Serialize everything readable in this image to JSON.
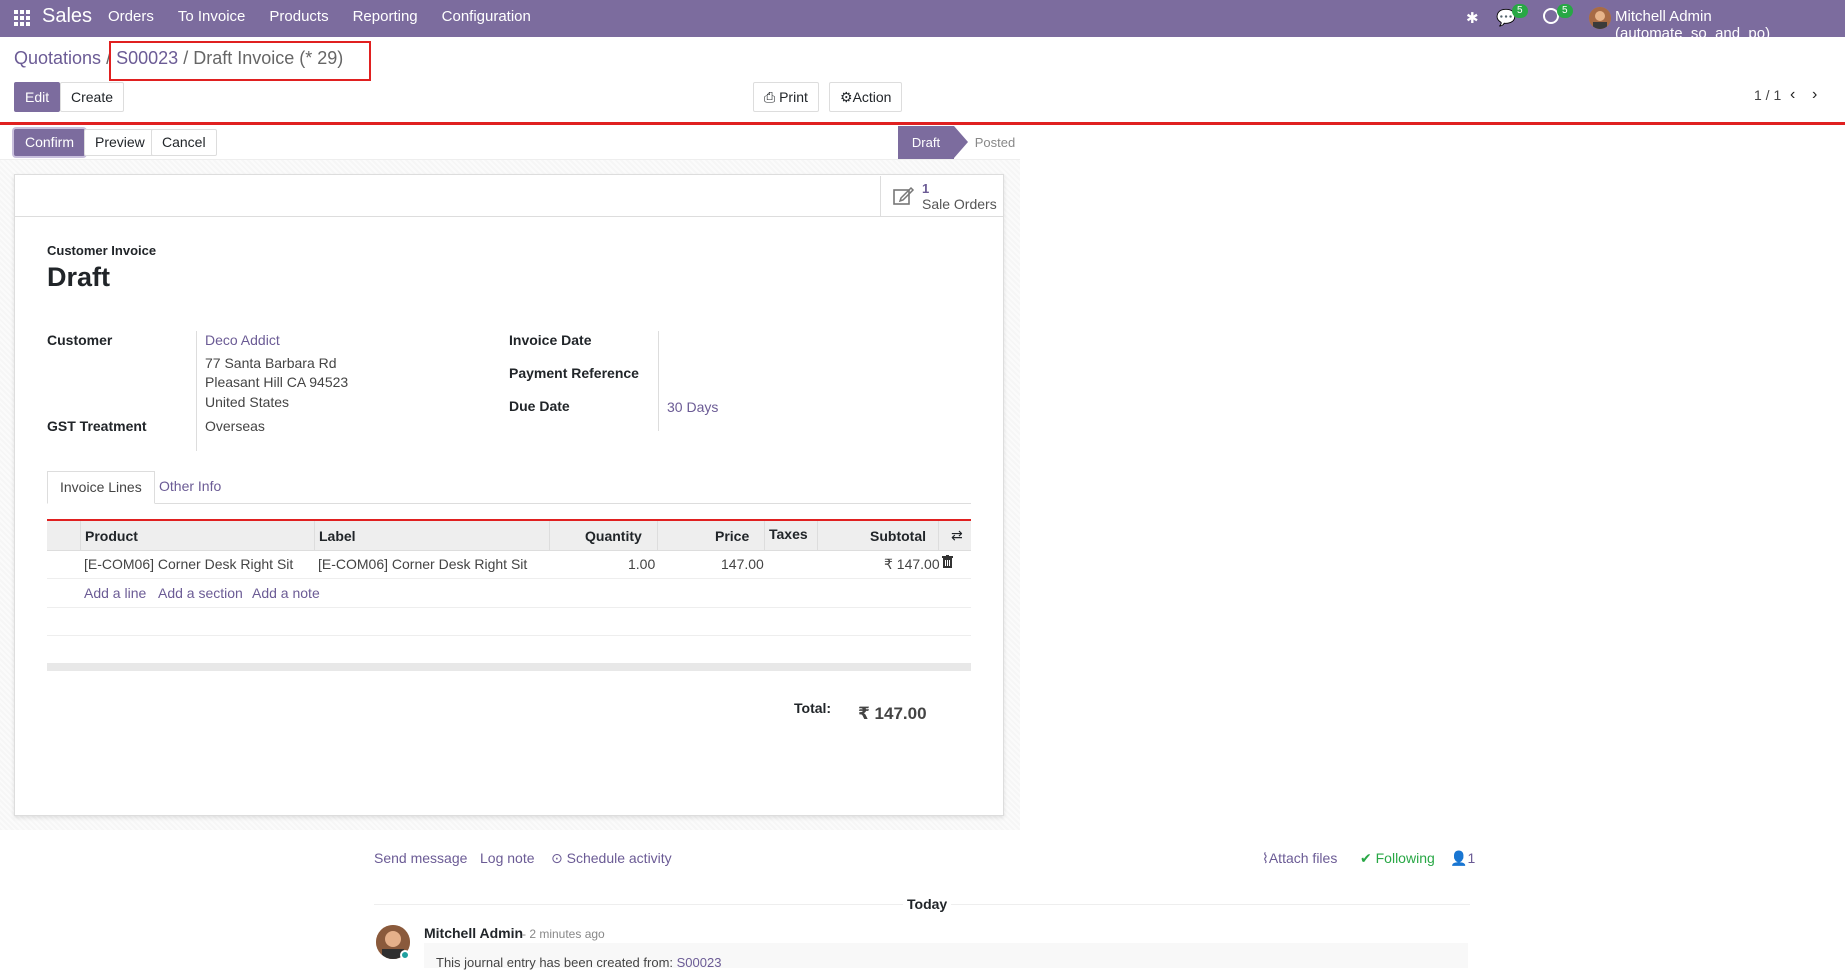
{
  "topbar": {
    "brand": "Sales",
    "menu": [
      "Orders",
      "To Invoice",
      "Products",
      "Reporting",
      "Configuration"
    ],
    "chat_badge": "5",
    "activity_badge": "5",
    "user": "Mitchell Admin (automate_so_and_po)"
  },
  "breadcrumb": {
    "root": "Quotations",
    "sep": "/",
    "order": "S00023",
    "sep2": "/",
    "current": "Draft Invoice (* 29)"
  },
  "controls": {
    "edit": "Edit",
    "create": "Create",
    "print": "Print",
    "action": "Action",
    "pager": "1 / 1"
  },
  "statusbar": {
    "confirm": "Confirm",
    "preview": "Preview",
    "cancel": "Cancel",
    "stages": [
      "Draft",
      "Posted"
    ]
  },
  "smart_button": {
    "count": "1",
    "label": "Sale Orders"
  },
  "form": {
    "type_label": "Customer Invoice",
    "title": "Draft",
    "customer_label": "Customer",
    "customer_name": "Deco Addict",
    "address": [
      "77 Santa Barbara Rd",
      "Pleasant Hill CA 94523",
      "United States"
    ],
    "gst_label": "GST Treatment",
    "gst_value": "Overseas",
    "invoice_date_label": "Invoice Date",
    "payment_ref_label": "Payment Reference",
    "due_date_label": "Due Date",
    "due_date_value": "30 Days"
  },
  "tabs": [
    "Invoice Lines",
    "Other Info"
  ],
  "lines": {
    "headers": [
      "Product",
      "Label",
      "Quantity",
      "Price",
      "Taxes",
      "Subtotal"
    ],
    "rows": [
      {
        "product": "[E-COM06] Corner Desk Right Sit",
        "label": "[E-COM06] Corner Desk Right Sit",
        "quantity": "1.00",
        "price": "147.00",
        "taxes": "",
        "subtotal": "₹ 147.00"
      }
    ],
    "add_line": "Add a line",
    "add_section": "Add a section",
    "add_note": "Add a note"
  },
  "totals": {
    "label": "Total:",
    "value": "₹ 147.00"
  },
  "chatter": {
    "send_message": "Send message",
    "log_note": "Log note",
    "schedule": "Schedule activity",
    "attach": "Attach files",
    "following": "Following",
    "followers": "1",
    "today": "Today",
    "author": "Mitchell Admin",
    "time": "- 2 minutes ago",
    "message_prefix": "This journal entry has been created from:",
    "message_link": "S00023"
  }
}
